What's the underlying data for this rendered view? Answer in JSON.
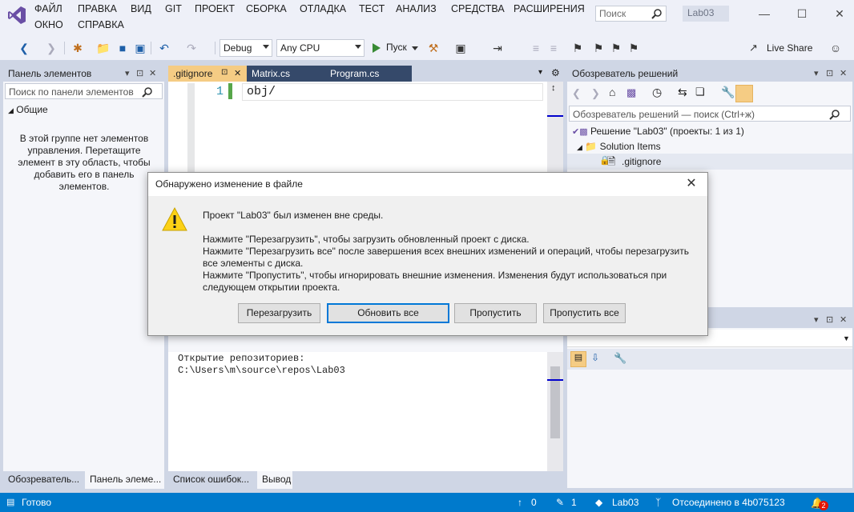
{
  "menu": {
    "items": [
      "ФАЙЛ",
      "ПРАВКА",
      "ВИД",
      "GIT",
      "ПРОЕКТ",
      "СБОРКА",
      "ОТЛАДКА",
      "ТЕСТ",
      "АНАЛИЗ",
      "СРЕДСТВА",
      "РАСШИРЕНИЯ"
    ],
    "items_row2": [
      "ОКНО",
      "СПРАВКА"
    ],
    "search_placeholder": "Поиск",
    "solution_name": "Lab03"
  },
  "toolbar": {
    "config": "Debug",
    "platform": "Any CPU",
    "run_label": "Пуск",
    "live_share": "Live Share"
  },
  "toolbox": {
    "title": "Панель элементов",
    "search_placeholder": "Поиск по панели элементов",
    "group": "Общие",
    "empty_message": "В этой группе нет элементов управления. Перетащите элемент в эту область, чтобы добавить его в панель элементов.",
    "bottom_tabs": [
      "Обозреватель...",
      "Панель элеме..."
    ]
  },
  "editor": {
    "tabs": [
      ".gitignore",
      "Matrix.cs",
      "Program.cs"
    ],
    "line_number": "1",
    "line_text": "obj/"
  },
  "output": {
    "lines": [
      "Открытие репозиториев:",
      "C:\\Users\\m\\source\\repos\\Lab03"
    ],
    "bottom_tabs": [
      "Список ошибок...",
      "Вывод"
    ]
  },
  "solution_explorer": {
    "title": "Обозреватель решений",
    "search_placeholder": "Обозреватель решений — поиск (Ctrl+ж)",
    "solution_label": "Решение \"Lab03\" (проекты: 1 из 1)",
    "folder": "Solution Items",
    "file": ".gitignore"
  },
  "dialog": {
    "title": "Обнаружено изменение в файле",
    "line1": "Проект \"Lab03\" был изменен вне среды.",
    "line2": "Нажмите \"Перезагрузить\", чтобы загрузить обновленный проект с диска.",
    "line3": "Нажмите \"Перезагрузить все\" после завершения всех внешних изменений и операций, чтобы перезагрузить все элементы с диска.",
    "line4": "Нажмите \"Пропустить\", чтобы игнорировать внешние изменения. Изменения будут использоваться при следующем открытии проекта.",
    "buttons": [
      "Перезагрузить",
      "Обновить все",
      "Пропустить",
      "Пропустить все"
    ]
  },
  "status": {
    "text": "Готово",
    "up_count": "0",
    "pencil_count": "1",
    "repo": "Lab03",
    "branch_status": "Отсоединено в 4b075123",
    "notifications": "2"
  }
}
